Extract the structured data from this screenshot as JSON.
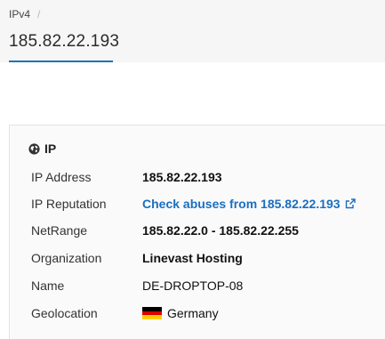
{
  "breadcrumb": {
    "item": "IPv4",
    "separator": "/"
  },
  "page": {
    "title": "185.82.22.193"
  },
  "section": {
    "heading": "IP",
    "icon": "globe-icon"
  },
  "rows": {
    "ip_address": {
      "label": "IP Address",
      "value": "185.82.22.193"
    },
    "ip_reputation": {
      "label": "IP Reputation",
      "value": "Check abuses from 185.82.22.193",
      "icon": "external-link-icon"
    },
    "netrange": {
      "label": "NetRange",
      "value": "185.82.22.0 - 185.82.22.255"
    },
    "organization": {
      "label": "Organization",
      "value": "Linevast Hosting"
    },
    "name": {
      "label": "Name",
      "value": "DE-DROPTOP-08"
    },
    "geolocation": {
      "label": "Geolocation",
      "value": "Germany",
      "flag_icon": "germany-flag-icon"
    }
  },
  "colors": {
    "accent": "#1a73b8",
    "link": "#1a6fc0",
    "header_bg": "#f6f6f6",
    "flag_black": "#000000",
    "flag_red": "#dd0000",
    "flag_gold": "#ffce00"
  }
}
